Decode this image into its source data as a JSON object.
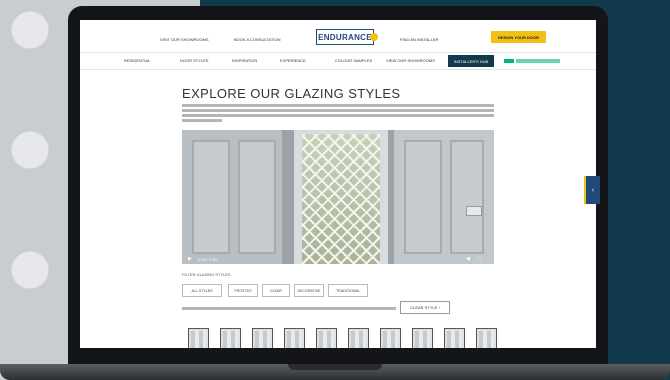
{
  "header": {
    "link_showroom": "VISIT OUR SHOWROOMS",
    "link_consultation": "BOOK A CONSULTATION",
    "logo": "ENDURANCE",
    "link_installer": "FIND AN INSTALLER",
    "book_button": "DESIGN YOUR DOOR"
  },
  "nav": {
    "residential": "RESIDENTIAL",
    "door_styles": "DOOR STYLES",
    "inspiration": "INSPIRATION",
    "experience": "EXPERIENCE",
    "colour_samples": "COLOUR SAMPLES",
    "view_showroom": "VIEW OUR SHOWROOMS",
    "installer_button": "INSTALLER'S HUB",
    "trustpilot": "Trustpilot"
  },
  "main": {
    "title": "EXPLORE OUR GLAZING STYLES",
    "video_time": "0:00 / 0:20",
    "filter_label": "FILTER GLAZING STYLES",
    "filters": [
      "ALL STYLES",
      "FROSTED",
      "CLEAR",
      "DECORATIVE",
      "TRADITIONAL"
    ],
    "clear_button": "CLEAR STYLE"
  },
  "icons": {
    "play": "play-icon",
    "volume": "volume-icon",
    "fullscreen": "fullscreen-icon",
    "side": "chevron-left-icon"
  }
}
